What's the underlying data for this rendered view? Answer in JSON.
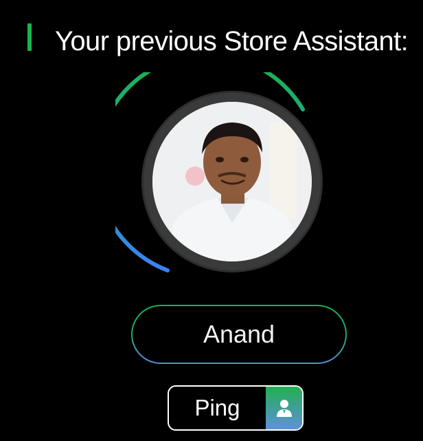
{
  "header": {
    "title": "Your previous Store Assistant:"
  },
  "assistant": {
    "name": "Anand",
    "photo_alt": "Anand",
    "ring_colors": {
      "start": "#1db34a",
      "end": "#3b82f6"
    }
  },
  "actions": {
    "ping_label": "Ping",
    "ping_icon": "user-icon"
  },
  "colors": {
    "accent": "#1db34a",
    "background": "#000000",
    "blue": "#5b8de0"
  }
}
